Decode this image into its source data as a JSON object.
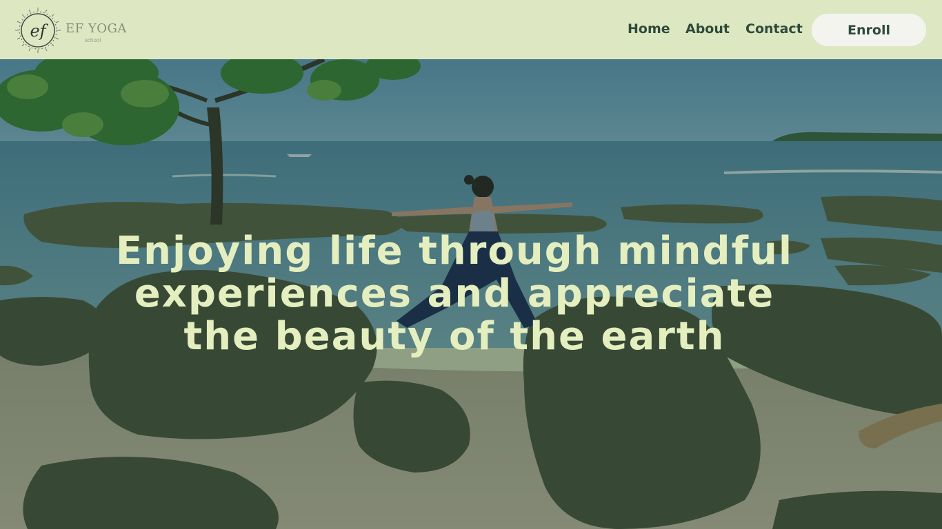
{
  "brand": {
    "logo_initials": "ef",
    "name": "EF YOGA",
    "tagline": "school"
  },
  "nav": {
    "items": [
      {
        "label": "Home"
      },
      {
        "label": "About"
      },
      {
        "label": "Contact"
      }
    ],
    "cta_label": "Enroll"
  },
  "hero": {
    "headline": "Enjoying life through mindful experiences and appreciate the beauty of the earth",
    "image_description_icon": "yoga-beach-photo"
  },
  "colors": {
    "header_bg": "#dde8c2",
    "nav_text": "#2f4a3b",
    "cta_bg": "#f4f4ef",
    "headline_text": "#e4eebf"
  }
}
